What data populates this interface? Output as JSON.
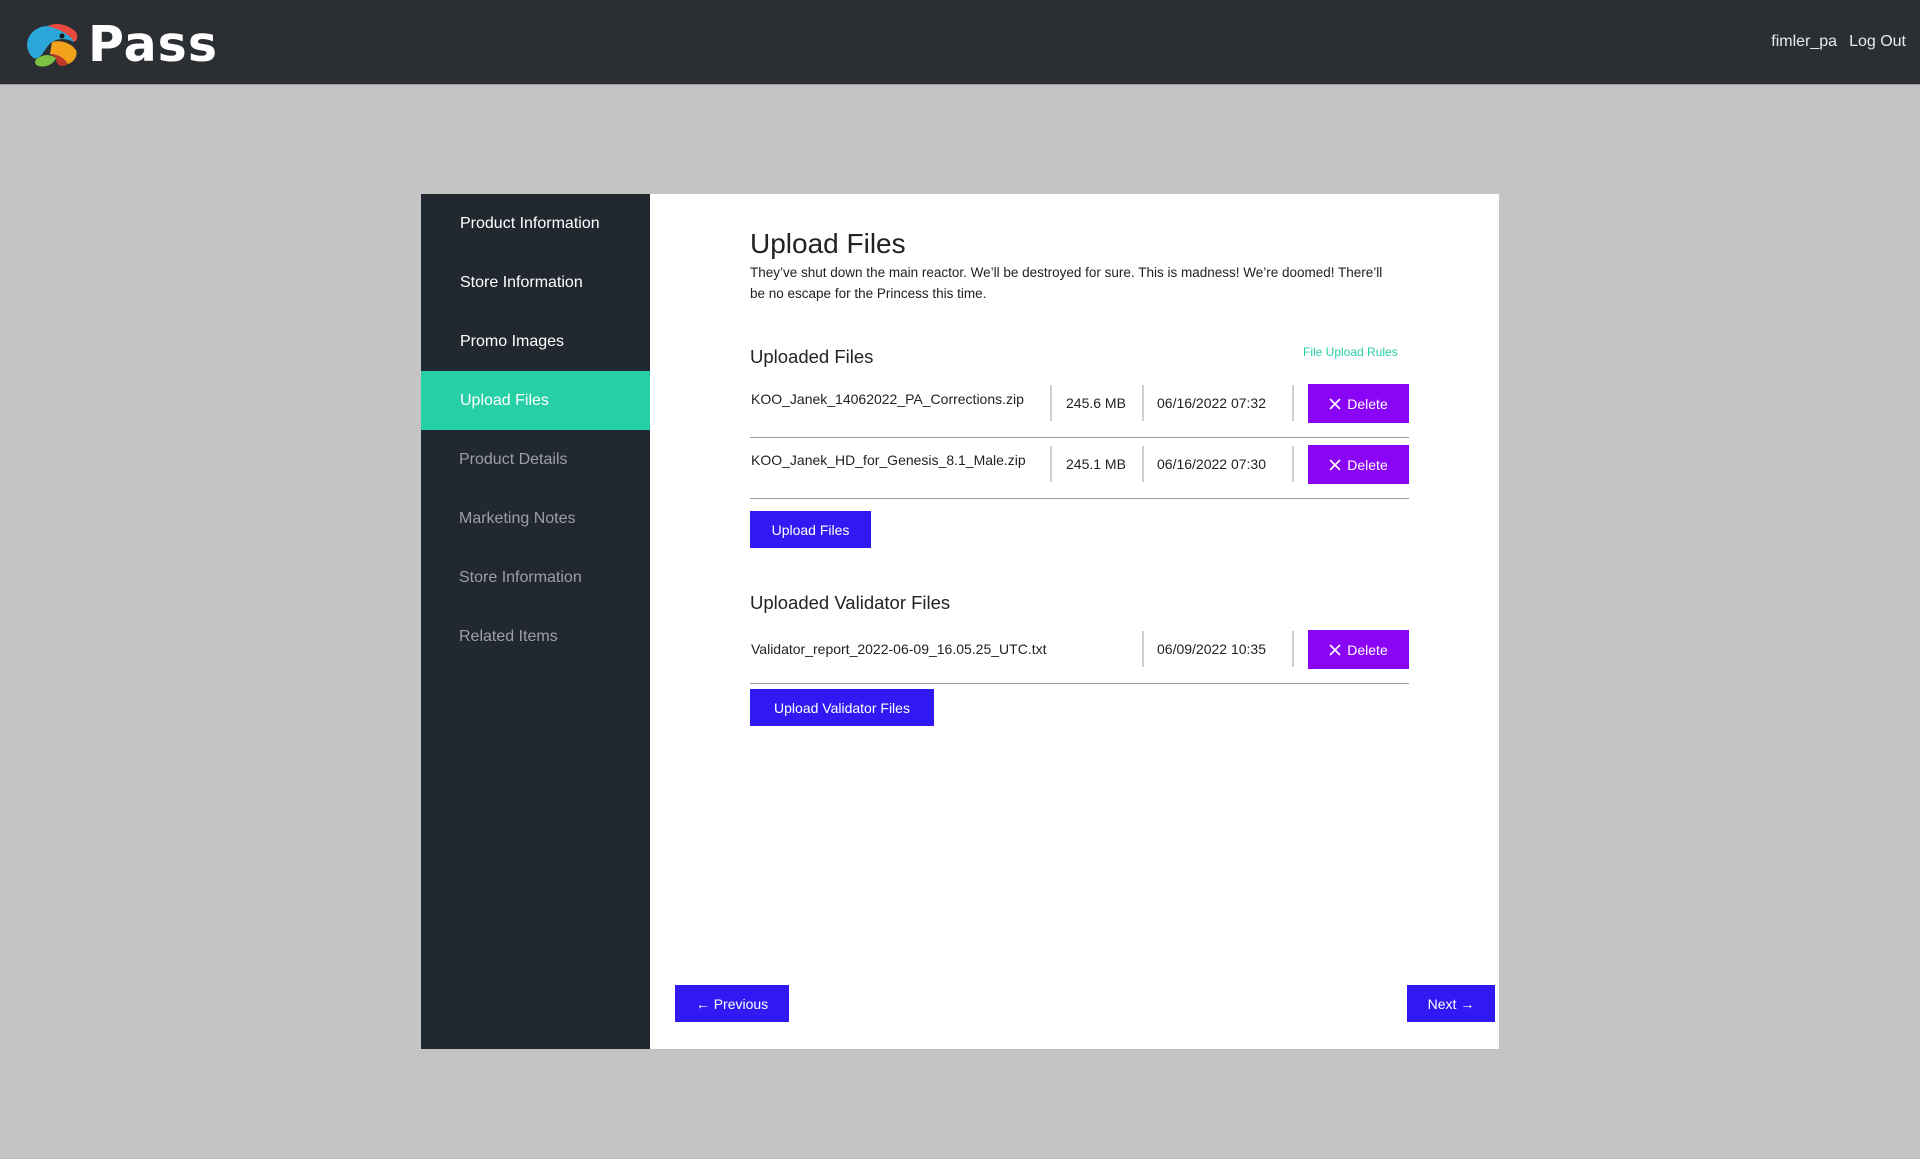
{
  "header": {
    "logo_text": "Pass",
    "username": "fimler_pa",
    "logout_label": "Log Out"
  },
  "sidebar": {
    "items": [
      {
        "label": "Product Information",
        "state": "done"
      },
      {
        "label": "Store Information",
        "state": "done"
      },
      {
        "label": "Promo Images",
        "state": "done"
      },
      {
        "label": "Upload Files",
        "state": "active"
      },
      {
        "label": "Product Details",
        "state": "pending"
      },
      {
        "label": "Marketing Notes",
        "state": "pending"
      },
      {
        "label": "Store Information",
        "state": "pending"
      },
      {
        "label": "Related Items",
        "state": "pending"
      }
    ]
  },
  "main": {
    "title": "Upload Files",
    "description": "They’ve shut down the main reactor. We’ll be destroyed for sure. This is madness! We’re doomed! There’ll be no escape for the Princess this time.",
    "uploaded_files": {
      "title": "Uploaded Files",
      "rules_link": "File Upload Rules",
      "files": [
        {
          "name": "KOO_Janek_14062022_PA_Corrections.zip",
          "size": "245.6 MB",
          "date": "06/16/2022 07:32",
          "delete_label": "Delete"
        },
        {
          "name": "KOO_Janek_HD_for_Genesis_8.1_Male.zip",
          "size": "245.1 MB",
          "date": "06/16/2022 07:30",
          "delete_label": "Delete"
        }
      ],
      "upload_button": "Upload Files"
    },
    "validator_files": {
      "title": "Uploaded Validator Files",
      "files": [
        {
          "name": "Validator_report_2022-06-09_16.05.25_UTC.txt",
          "date": "06/09/2022 10:35",
          "delete_label": "Delete"
        }
      ],
      "upload_button": "Upload Validator Files"
    },
    "nav": {
      "previous_label": "← Previous",
      "next_label": "Next →"
    }
  },
  "colors": {
    "topbar": "#2b2f34",
    "sidebar": "#22282f",
    "active": "#27cfa6",
    "delete": "#8a05f5",
    "primary": "#3019f2",
    "page_bg": "#c4c4c4"
  }
}
